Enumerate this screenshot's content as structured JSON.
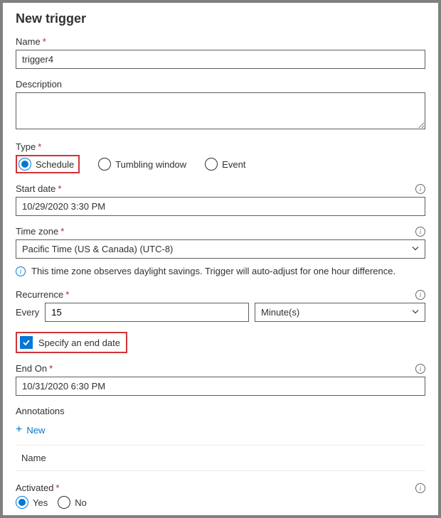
{
  "panel": {
    "title": "New trigger"
  },
  "name": {
    "label": "Name",
    "value": "trigger4"
  },
  "description": {
    "label": "Description",
    "value": ""
  },
  "type": {
    "label": "Type",
    "options": {
      "schedule": "Schedule",
      "tumbling": "Tumbling window",
      "event": "Event"
    },
    "selected": "schedule"
  },
  "startDate": {
    "label": "Start date",
    "value": "10/29/2020 3:30 PM"
  },
  "timeZone": {
    "label": "Time zone",
    "value": "Pacific Time (US & Canada) (UTC-8)",
    "note": "This time zone observes daylight savings. Trigger will auto-adjust for one hour difference."
  },
  "recurrence": {
    "label": "Recurrence",
    "everyLabel": "Every",
    "interval": "15",
    "unit": "Minute(s)"
  },
  "specifyEndDate": {
    "label": "Specify an end date",
    "checked": true
  },
  "endOn": {
    "label": "End On",
    "value": "10/31/2020 6:30 PM"
  },
  "annotations": {
    "label": "Annotations",
    "newLabel": "New",
    "columnHeader": "Name"
  },
  "activated": {
    "label": "Activated",
    "options": {
      "yes": "Yes",
      "no": "No"
    },
    "selected": "yes"
  }
}
